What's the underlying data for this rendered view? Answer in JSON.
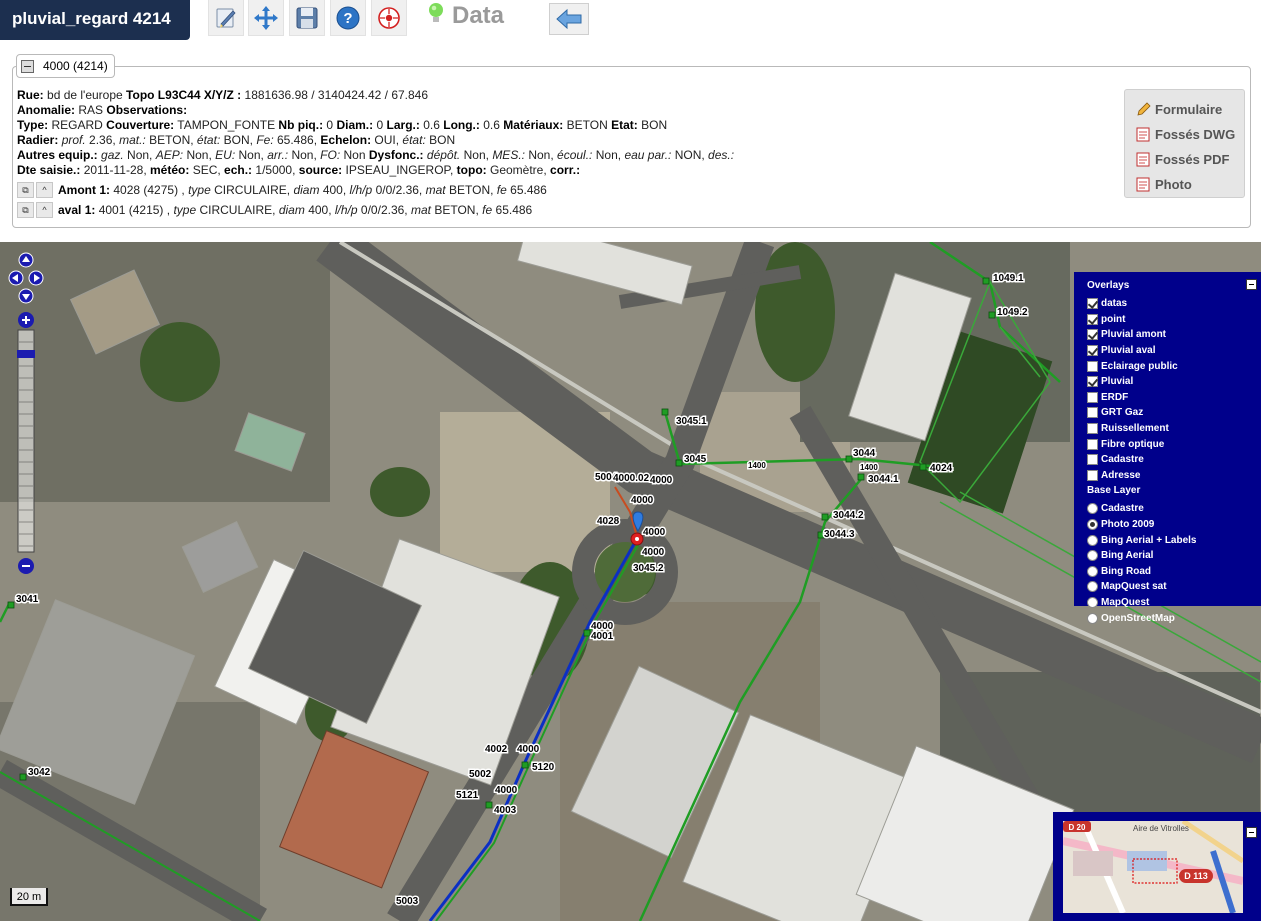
{
  "app_title": "pluvial_regard 4214",
  "toolbar": {
    "tools": [
      "edit-icon",
      "move-icon",
      "save-icon",
      "help-icon",
      "locate-icon"
    ],
    "data_label": "Data",
    "back_icon": "back-arrow-icon"
  },
  "info": {
    "legend": "4000 (4214)",
    "rue_label": "Rue:",
    "rue": "bd de l'europe",
    "topo_label": "Topo L93C44 X/Y/Z :",
    "topo": "1881636.98 / 3140424.42 / 67.846",
    "anomalie_label": "Anomalie:",
    "anomalie": "RAS",
    "observations_label": "Observations:",
    "type_label": "Type:",
    "type": "REGARD",
    "couverture_label": "Couverture:",
    "couverture": "TAMPON_FONTE",
    "nbpiq_label": "Nb piq.:",
    "nbpiq": "0",
    "diam_label": "Diam.:",
    "diam": "0",
    "larg_label": "Larg.:",
    "larg": "0.6",
    "long_label": "Long.:",
    "long": "0.6",
    "materiaux_label": "Matériaux:",
    "materiaux": "BETON",
    "etat_label": "Etat:",
    "etat": "BON",
    "radier_label": "Radier:",
    "prof_label": "prof.",
    "prof": "2.36,",
    "mat_label": "mat.:",
    "mat": "BETON,",
    "etat2_label": "état:",
    "etat2": "BON,",
    "fe_label": "Fe:",
    "fe": "65.486,",
    "echelon_label": "Echelon:",
    "echelon": "OUI,",
    "etat3_label": "état:",
    "etat3": "BON",
    "autres_label": "Autres equip.:",
    "gaz_label": "gaz.",
    "gaz": "Non,",
    "aep_label": "AEP:",
    "aep": "Non,",
    "eu_label": "EU:",
    "eu": "Non,",
    "arr_label": "arr.:",
    "arr": "Non,",
    "fo_label": "FO:",
    "fo": "Non",
    "dysfonc_label": "Dysfonc.:",
    "depot_label": "dépôt.",
    "depot": "Non,",
    "mes_label": "MES.:",
    "mes": "Non,",
    "ecoul_label": "écoul.:",
    "ecoul": "Non,",
    "eaupar_label": "eau par.:",
    "eaupar": "NON,",
    "des_label": "des.:",
    "dte_label": "Dte saisie.:",
    "dte": "2011-11-28,",
    "meteo_label": "météo:",
    "meteo": "SEC,",
    "ech_label": "ech.:",
    "ech": "1/5000,",
    "source_label": "source:",
    "source": "IPSEAU_INGEROP,",
    "topo2_label": "topo:",
    "topo2": "Geomètre,",
    "corr_label": "corr.:",
    "amont_label": "Amont 1:",
    "amont_ref": "4028 (4275) ,",
    "amont_type_label": "type",
    "amont_type": "CIRCULAIRE,",
    "amont_diam_label": "diam",
    "amont_diam": "400,",
    "amont_lhp_label": "l/h/p",
    "amont_lhp": "0/0/2.36,",
    "amont_mat_label": "mat",
    "amont_mat": "BETON,",
    "amont_fe_label": "fe",
    "amont_fe": "65.486",
    "aval_label": "aval 1:",
    "aval_ref": "4001 (4215) ,",
    "aval_type_label": "type",
    "aval_type": "CIRCULAIRE,",
    "aval_diam_label": "diam",
    "aval_diam": "400,",
    "aval_lhp_label": "l/h/p",
    "aval_lhp": "0/0/2.36,",
    "aval_mat_label": "mat",
    "aval_mat": "BETON,",
    "aval_fe_label": "fe",
    "aval_fe": "65.486"
  },
  "actions": {
    "formulaire": "Formulaire",
    "fosses_dwg": "Fossés DWG",
    "fosses_pdf": "Fossés PDF",
    "photo": "Photo"
  },
  "layers": {
    "overlays_title": "Overlays",
    "overlays": [
      {
        "label": "datas",
        "checked": true
      },
      {
        "label": "point",
        "checked": true
      },
      {
        "label": "Pluvial amont",
        "checked": true
      },
      {
        "label": "Pluvial aval",
        "checked": true
      },
      {
        "label": "Eclairage public",
        "checked": false
      },
      {
        "label": "Pluvial",
        "checked": true
      },
      {
        "label": "ERDF",
        "checked": false
      },
      {
        "label": "GRT Gaz",
        "checked": false
      },
      {
        "label": "Ruissellement",
        "checked": false
      },
      {
        "label": "Fibre optique",
        "checked": false
      },
      {
        "label": "Cadastre",
        "checked": false
      },
      {
        "label": "Adresse",
        "checked": false
      }
    ],
    "base_title": "Base Layer",
    "base": [
      {
        "label": "Cadastre",
        "checked": false
      },
      {
        "label": "Photo 2009",
        "checked": true
      },
      {
        "label": "Bing Aerial + Labels",
        "checked": false
      },
      {
        "label": "Bing Aerial",
        "checked": false
      },
      {
        "label": "Bing Road",
        "checked": false
      },
      {
        "label": "MapQuest sat",
        "checked": false
      },
      {
        "label": "MapQuest",
        "checked": false
      },
      {
        "label": "OpenStreetMap",
        "checked": false
      }
    ]
  },
  "map_labels": [
    "1049.1",
    "1049.2",
    "3045.1",
    "3045",
    "1400",
    "3044",
    "1400",
    "4024",
    "3044.1",
    "3044.2",
    "3044.3",
    "5004",
    "4000.02",
    "4000",
    "4000",
    "4028",
    "4000",
    "4000",
    "3045.2",
    "4000",
    "4001",
    "4002",
    "4000",
    "5120",
    "5002",
    "5121",
    "4000",
    "4003",
    "5003",
    "3041",
    "3042"
  ],
  "overview": {
    "label_top": "Aire de Vitrolles",
    "route_20": "D 20",
    "route_113": "D 113"
  },
  "scale": "20 m"
}
